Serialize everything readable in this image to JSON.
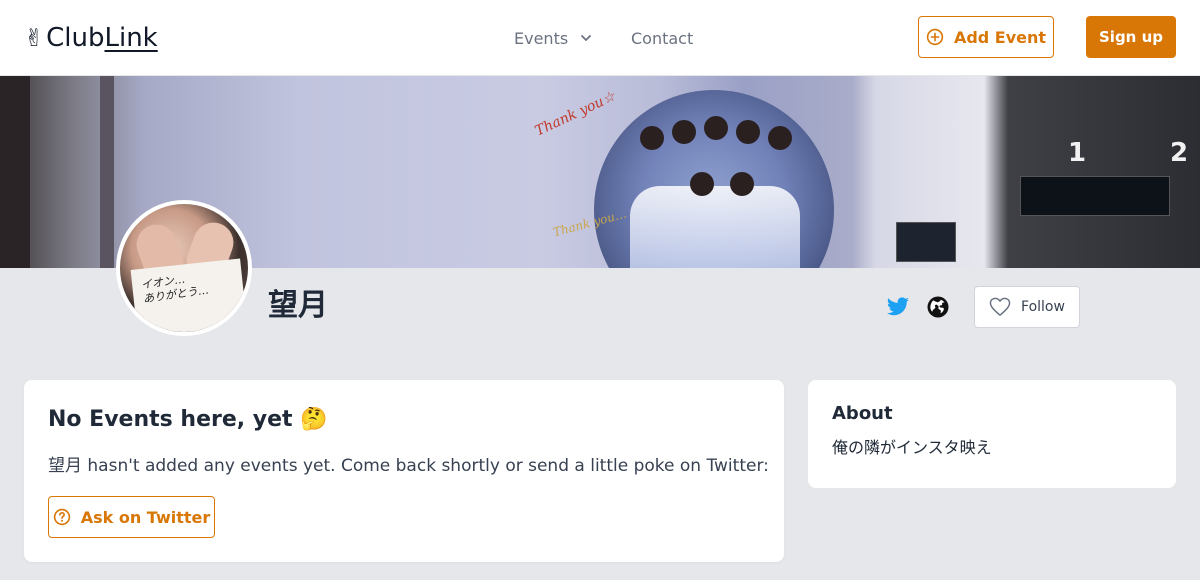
{
  "header": {
    "logo_emoji": "✌",
    "logo_club": "Club",
    "logo_link": "Link",
    "nav_events": "Events",
    "nav_contact": "Contact",
    "add_event": "Add Event",
    "sign_up": "Sign up"
  },
  "banner": {
    "sign_text_1": "Thank you☆",
    "sign_text_2": "Thank you…",
    "platform_1": "1",
    "platform_2": "2"
  },
  "profile": {
    "name": "望月",
    "follow_label": "Follow",
    "avatar_scribble_1": "イオン…",
    "avatar_scribble_2": "ありがとう…"
  },
  "events_card": {
    "title": "No Events here, yet 🤔",
    "description": "望月 hasn't added any events yet. Come back shortly or send a little poke on Twitter:",
    "ask_button": "Ask on Twitter"
  },
  "about_card": {
    "heading": "About",
    "text": "俺の隣がインスタ映え"
  },
  "colors": {
    "accent": "#d97706",
    "twitter": "#1da1f2",
    "background": "#e5e7eb"
  },
  "icons": {
    "add_event": "plus-circle-icon",
    "events_dropdown": "chevron-down-icon",
    "twitter": "twitter-icon",
    "website": "globe-icon",
    "follow": "heart-icon",
    "ask": "question-circle-icon"
  }
}
